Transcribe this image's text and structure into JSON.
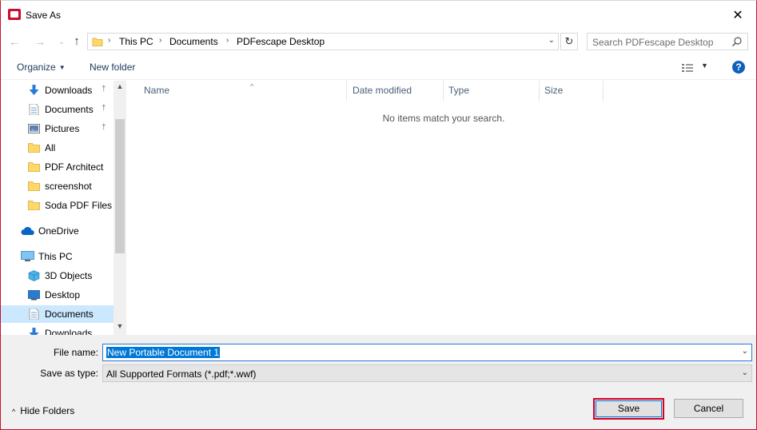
{
  "window": {
    "title": "Save As",
    "close_glyph": "✕"
  },
  "nav": {
    "back_glyph": "←",
    "forward_glyph": "→",
    "recent_glyph": "⌄",
    "up_glyph": "↑",
    "refresh_glyph": "↻",
    "breadcrumb": [
      "This PC",
      "Documents",
      "PDFescape Desktop"
    ],
    "crumb_sep": "›",
    "dropdown_glyph": "⌄"
  },
  "search": {
    "placeholder": "Search PDFescape Desktop"
  },
  "toolbar": {
    "organize_label": "Organize",
    "organize_caret": "▼",
    "new_folder_label": "New folder",
    "view_caret": "▼",
    "help_label": "?"
  },
  "sidebar": {
    "scroll_up": "▲",
    "scroll_down": "▼",
    "items": [
      {
        "label": "Downloads",
        "icon": "download-arrow-icon",
        "pinned": true
      },
      {
        "label": "Documents",
        "icon": "document-icon",
        "pinned": true
      },
      {
        "label": "Pictures",
        "icon": "pictures-icon",
        "pinned": true
      },
      {
        "label": "All",
        "icon": "folder-icon",
        "pinned": false
      },
      {
        "label": "PDF Architect",
        "icon": "folder-icon",
        "pinned": false
      },
      {
        "label": "screenshot",
        "icon": "folder-icon",
        "pinned": false
      },
      {
        "label": "Soda PDF Files",
        "icon": "folder-icon",
        "pinned": false
      },
      {
        "label": "OneDrive",
        "icon": "cloud-icon",
        "pinned": false
      },
      {
        "label": "This PC",
        "icon": "computer-icon",
        "pinned": false
      },
      {
        "label": "3D Objects",
        "icon": "cube-icon",
        "pinned": false
      },
      {
        "label": "Desktop",
        "icon": "desktop-icon",
        "pinned": false
      },
      {
        "label": "Documents",
        "icon": "document-icon",
        "pinned": false,
        "selected": true
      },
      {
        "label": "Downloads",
        "icon": "download-arrow-icon",
        "pinned": false
      }
    ],
    "pin_glyph": "📌"
  },
  "filelist": {
    "columns": [
      "Name",
      "Date modified",
      "Type",
      "Size"
    ],
    "sort_caret": "^",
    "empty_message": "No items match your search."
  },
  "form": {
    "filename_label": "File name:",
    "filename_value": "New Portable Document 1",
    "savetype_label": "Save as type:",
    "savetype_value": "All Supported Formats (*.pdf;*.wwf)",
    "dropdown_glyph": "⌄"
  },
  "footer": {
    "hide_folders_caret": "^",
    "hide_folders_label": "Hide Folders",
    "save_label": "Save",
    "cancel_label": "Cancel"
  },
  "colors": {
    "accent": "#0078d7",
    "highlight_border": "#d3002d",
    "selection": "#cce8ff",
    "folder": "#ffd867"
  }
}
